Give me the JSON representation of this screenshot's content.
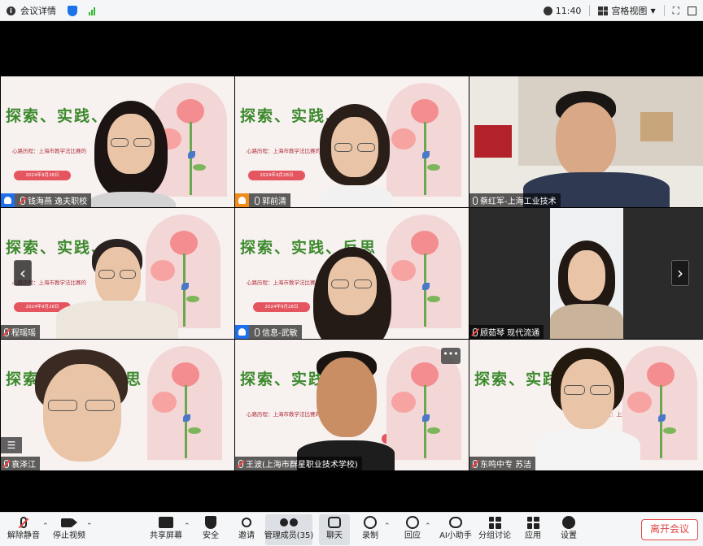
{
  "topbar": {
    "meeting_info": "会议详情",
    "time": "11:40",
    "view_label": "宫格视图"
  },
  "slide": {
    "title_full": "探索、实践、",
    "title_mid": "探索、实践、反思",
    "subtitle": "心路历程：上海市教学法比赛的",
    "date_pill": "2024年9月28日"
  },
  "participants": [
    {
      "name": "钱海燕 逸夫职校",
      "role": "host"
    },
    {
      "name": "郭前清",
      "role": "cohost"
    },
    {
      "name": "蔡红军-上海工业技术",
      "role": "none"
    },
    {
      "name": "程瑶瑶",
      "role": "none"
    },
    {
      "name": "信息-武敏",
      "role": "host"
    },
    {
      "name": "顾茹琴 现代流通",
      "role": "none"
    },
    {
      "name": "袁泽江",
      "role": "none"
    },
    {
      "name": "王波(上海市群星职业技术学校)",
      "role": "none"
    },
    {
      "name": "东鸣中专 苏洁",
      "role": "none"
    }
  ],
  "toolbar": {
    "unmute": "解除静音",
    "stop_video": "停止视频",
    "share": "共享屏幕",
    "security": "安全",
    "invite": "邀请",
    "manage": "管理成员(35)",
    "chat": "聊天",
    "record": "录制",
    "reactions": "回应",
    "ai": "AI小助手",
    "breakout": "分组讨论",
    "apps": "应用",
    "settings": "设置",
    "leave": "离开会议"
  },
  "colors": {
    "accent": "#1f6feb",
    "leave": "#e04646",
    "slide_title": "#3d8a2e"
  }
}
